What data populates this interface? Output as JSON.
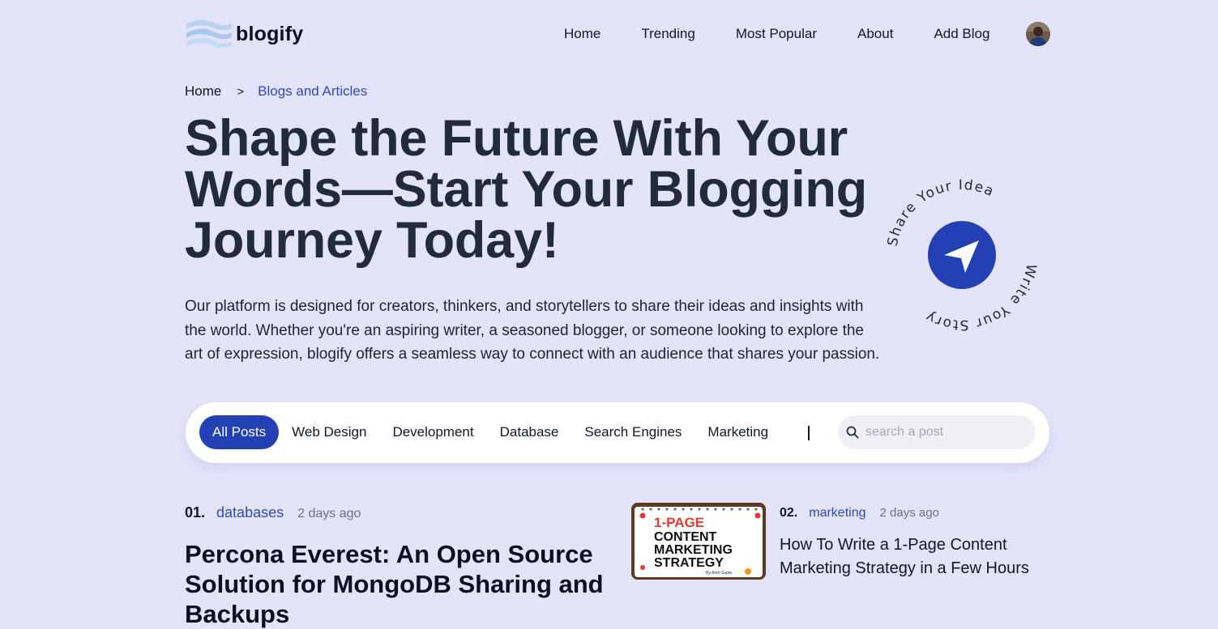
{
  "brand": {
    "name": "blogify",
    "logo_icon": "wave-logo-icon"
  },
  "nav": {
    "links": [
      "Home",
      "Trending",
      "Most Popular",
      "About",
      "Add Blog"
    ],
    "avatar_icon": "user-avatar"
  },
  "breadcrumb": {
    "home": "Home",
    "separator": ">",
    "current": "Blogs and Articles"
  },
  "hero": {
    "title": "Shape the Future With Your Words—Start Your Blogging Journey Today!",
    "description": "Our platform is designed for creators, thinkers, and storytellers to share their ideas and insights with the world. Whether you're an aspiring writer, a seasoned blogger, or someone looking to explore the art of expression, blogify offers a seamless way to connect with an audience that shares your passion."
  },
  "badge": {
    "text_top": "Share Your Idea",
    "text_bottom": "Write Your Story",
    "icon": "send-arrow-icon"
  },
  "filters": {
    "tabs": [
      "All Posts",
      "Web Design",
      "Development",
      "Database",
      "Search Engines",
      "Marketing"
    ],
    "active": "All Posts",
    "search_placeholder": "search a post"
  },
  "posts": [
    {
      "number": "01.",
      "category": "databases",
      "date": "2 days ago",
      "title": "Percona Everest: An Open Source Solution for MongoDB Sharing and Backups"
    },
    {
      "number": "02.",
      "category": "marketing",
      "date": "2 days ago",
      "title": "How To Write a 1-Page Content Marketing Strategy in a Few Hours",
      "thumbnail": {
        "line1": "1-PAGE",
        "line2": "CONTENT",
        "line3": "MARKETING",
        "line4": "STRATEGY",
        "byline": "By Amit Gupta"
      }
    }
  ],
  "colors": {
    "background": "#e3e3fa",
    "accent": "#2340b4",
    "link": "#2f49b8",
    "heading": "#222b3a"
  }
}
